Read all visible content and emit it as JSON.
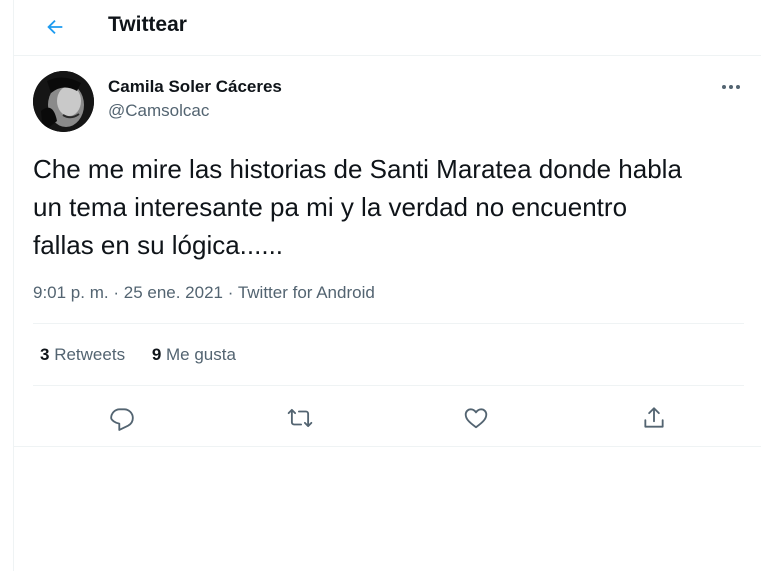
{
  "header": {
    "title": "Twittear",
    "back_icon": "arrow-left-icon"
  },
  "tweet": {
    "author_name": "Camila Soler Cáceres",
    "author_handle": "@Camsolcac",
    "text": "Che me mire las historias de Santi Maratea donde habla\nun tema interesante pa mi y la verdad no encuentro\nfallas en su lógica......",
    "time": "9:01 p. m.",
    "date": "25 ene. 2021",
    "source": "Twitter for Android",
    "retweets_count": "3",
    "retweets_label": "Retweets",
    "likes_count": "9",
    "likes_label": "Me gusta"
  },
  "actions": [
    "reply-icon",
    "retweet-icon",
    "like-icon",
    "share-icon"
  ],
  "colors": {
    "accent": "#1d9bf0",
    "muted": "#536471",
    "text": "#0f1419",
    "border": "#eff3f4"
  }
}
